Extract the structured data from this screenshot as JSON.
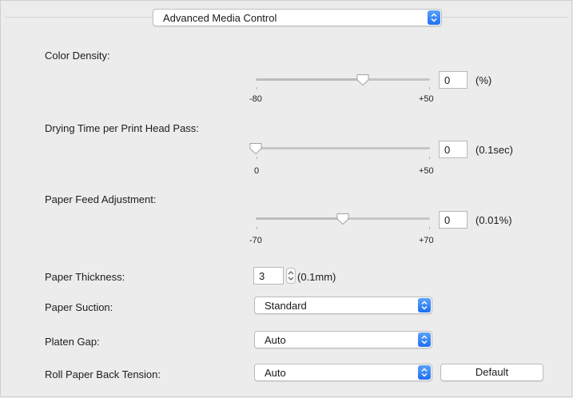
{
  "header": {
    "mode_select": "Advanced Media Control"
  },
  "sliders": [
    {
      "label": "Color Density:",
      "value": "0",
      "unit": "(%)",
      "min_label": "-80",
      "max_label": "+50",
      "min": -80,
      "max": 50,
      "current": 0
    },
    {
      "label": "Drying Time per Print Head Pass:",
      "value": "0",
      "unit": "(0.1sec)",
      "min_label": "0",
      "max_label": "+50",
      "min": 0,
      "max": 50,
      "current": 0
    },
    {
      "label": "Paper Feed Adjustment:",
      "value": "0",
      "unit": "(0.01%)",
      "min_label": "-70",
      "max_label": "+70",
      "min": -70,
      "max": 70,
      "current": 0
    }
  ],
  "thickness": {
    "label": "Paper Thickness:",
    "value": "3",
    "unit": "(0.1mm)"
  },
  "suction": {
    "label": "Paper Suction:",
    "value": "Standard"
  },
  "platen_gap": {
    "label": "Platen Gap:",
    "value": "Auto"
  },
  "tension": {
    "label": "Roll Paper Back Tension:",
    "value": "Auto",
    "default_button": "Default"
  },
  "colors": {
    "accent": "#1f6ff2",
    "background": "#ececec"
  },
  "icons": {
    "popup": "up-down-arrows-icon",
    "stepper": "stepper-icon",
    "thumb": "slider-thumb-icon"
  }
}
